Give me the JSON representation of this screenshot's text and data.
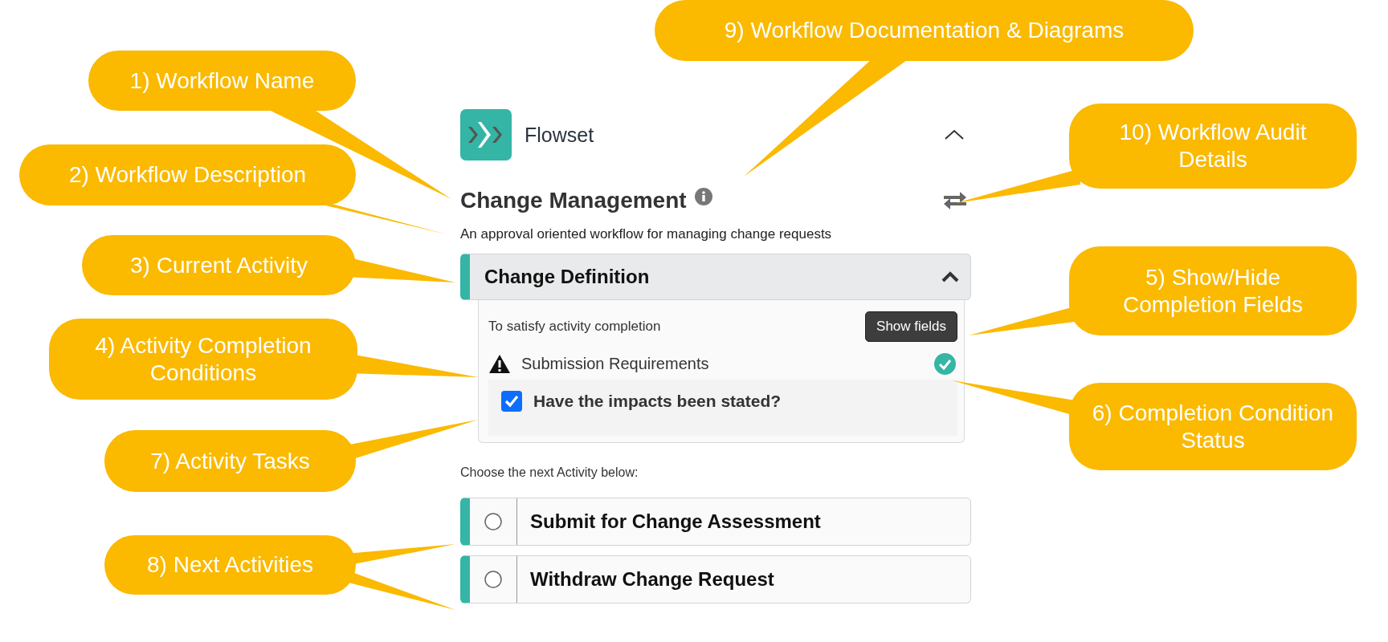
{
  "app": {
    "name": "Flowset",
    "expanded": true
  },
  "workflow": {
    "title": "Change Management",
    "description": "An approval oriented workflow for managing change requests"
  },
  "current_activity": {
    "title": "Change Definition",
    "expanded": true,
    "completion_prompt": "To satisfy activity completion",
    "show_fields_button": "Show fields",
    "conditions": [
      {
        "name": "Submission Requirements",
        "complete": true,
        "tasks": [
          {
            "label": "Have the impacts been stated?",
            "checked": true
          }
        ]
      }
    ]
  },
  "next_prompt": "Choose the next Activity below:",
  "next_activities": [
    {
      "title": "Submit for Change Assessment",
      "selected": false
    },
    {
      "title": "Withdraw Change Request",
      "selected": false
    }
  ],
  "callouts": [
    {
      "label": "9) Workflow Documentation & Diagrams"
    },
    {
      "label": "1) Workflow Name"
    },
    {
      "label": "10) Workflow Audit Details"
    },
    {
      "label": "2) Workflow Description"
    },
    {
      "label": "3) Current Activity"
    },
    {
      "label": "5) Show/Hide Completion Fields"
    },
    {
      "label": "4) Activity Completion Conditions"
    },
    {
      "label": "6) Completion Condition Status"
    },
    {
      "label": "7) Activity Tasks"
    },
    {
      "label": "8) Next Activities"
    }
  ]
}
